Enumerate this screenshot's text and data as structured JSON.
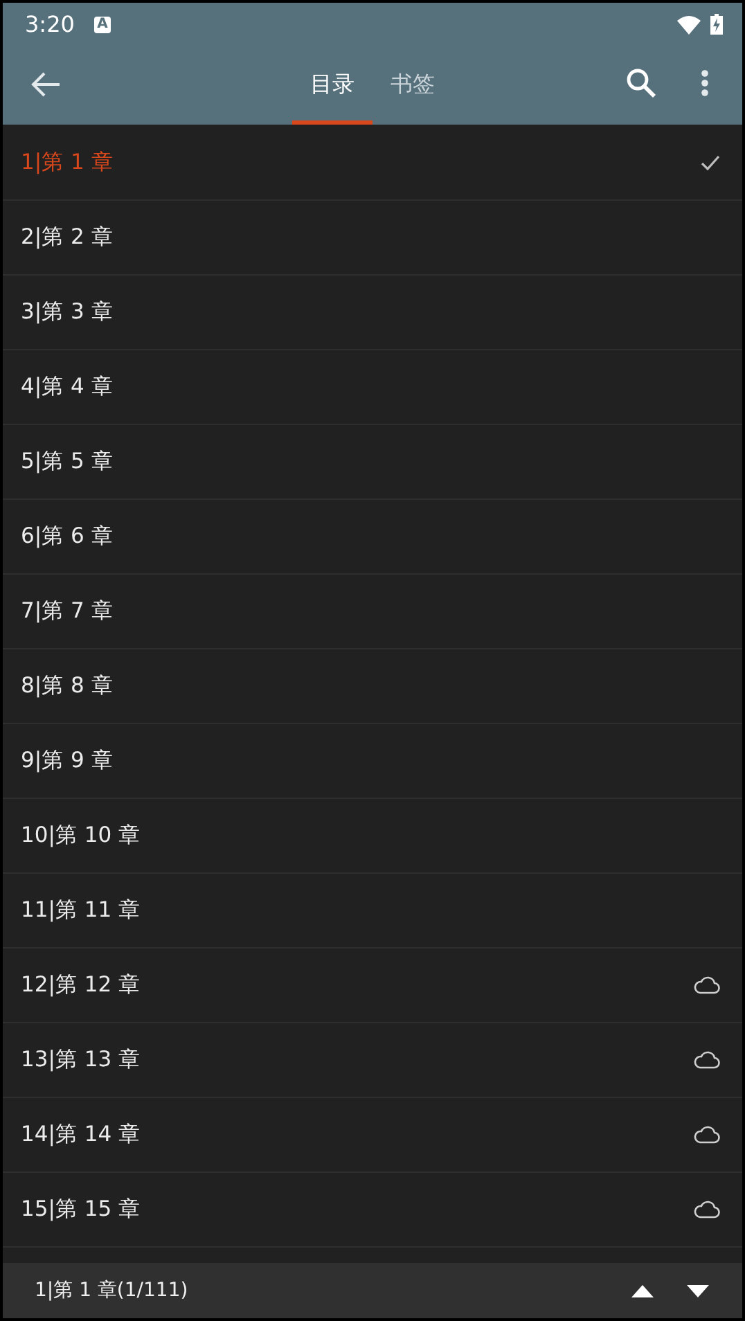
{
  "status_bar": {
    "time": "3:20",
    "notification": "A"
  },
  "toolbar": {
    "tabs": [
      {
        "label": "目录",
        "selected": true
      },
      {
        "label": "书签",
        "selected": false
      }
    ]
  },
  "chapters": [
    {
      "title": "1|第 1 章",
      "selected": true,
      "downloaded": true
    },
    {
      "title": "2|第 2 章",
      "selected": false,
      "downloaded": true
    },
    {
      "title": "3|第 3 章",
      "selected": false,
      "downloaded": true
    },
    {
      "title": "4|第 4 章",
      "selected": false,
      "downloaded": true
    },
    {
      "title": "5|第 5 章",
      "selected": false,
      "downloaded": true
    },
    {
      "title": "6|第 6 章",
      "selected": false,
      "downloaded": true
    },
    {
      "title": "7|第 7 章",
      "selected": false,
      "downloaded": true
    },
    {
      "title": "8|第 8 章",
      "selected": false,
      "downloaded": true
    },
    {
      "title": "9|第 9 章",
      "selected": false,
      "downloaded": true
    },
    {
      "title": "10|第 10 章",
      "selected": false,
      "downloaded": true
    },
    {
      "title": "11|第 11 章",
      "selected": false,
      "downloaded": true
    },
    {
      "title": "12|第 12 章",
      "selected": false,
      "downloaded": false
    },
    {
      "title": "13|第 13 章",
      "selected": false,
      "downloaded": false
    },
    {
      "title": "14|第 14 章",
      "selected": false,
      "downloaded": false
    },
    {
      "title": "15|第 15 章",
      "selected": false,
      "downloaded": false
    }
  ],
  "bottom_bar": {
    "position": "1|第 1 章(1/111)"
  }
}
